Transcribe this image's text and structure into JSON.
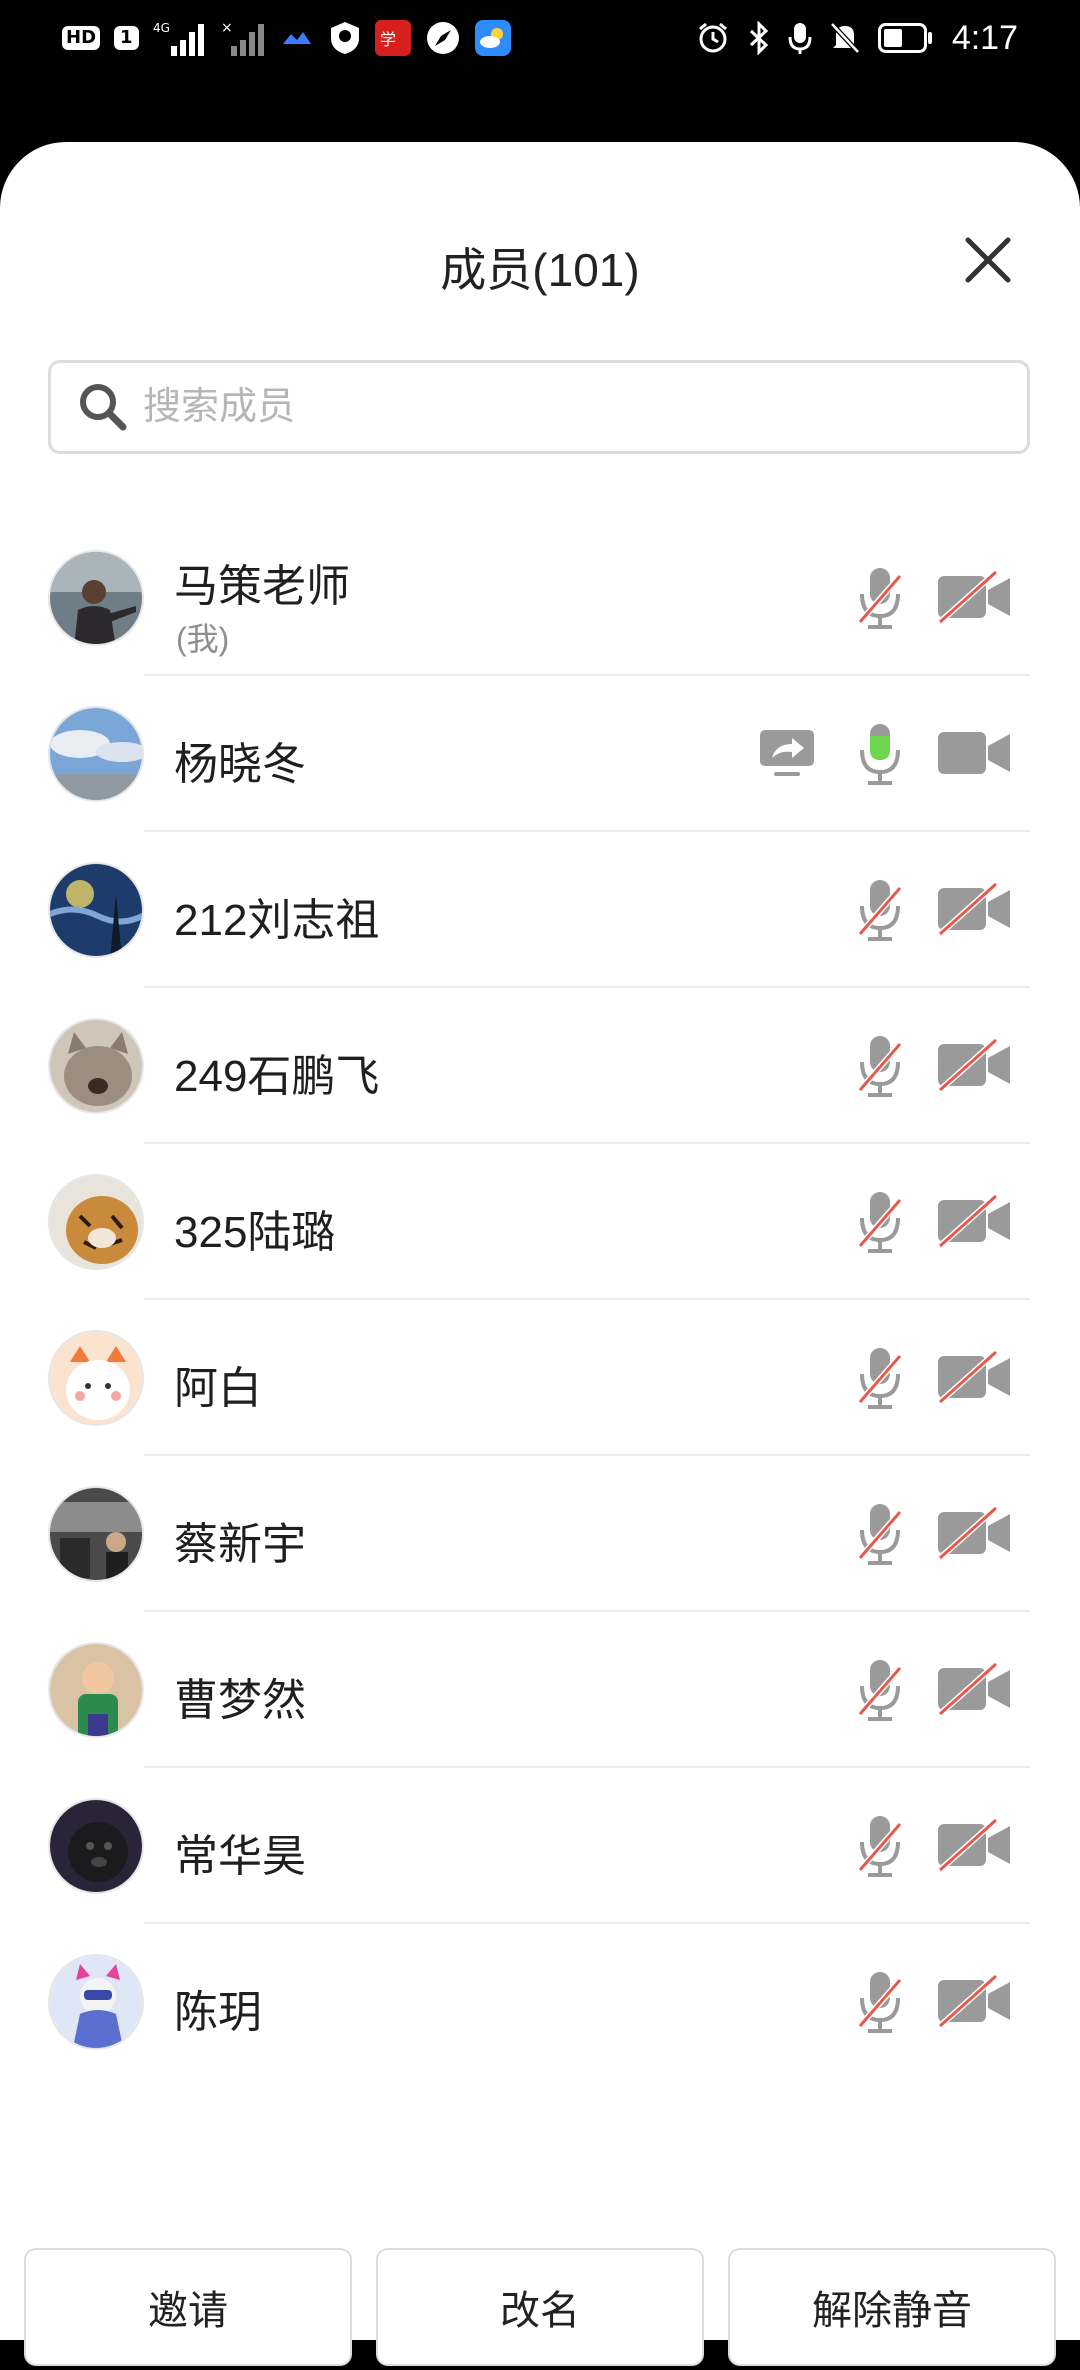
{
  "status_bar": {
    "time": "4:17",
    "left_icons": [
      "hd-icon",
      "sim-icon",
      "signal-4g-icon",
      "signal-x-icon",
      "app-cloud-icon",
      "shield-icon",
      "news-app-icon",
      "compass-icon",
      "weather-icon"
    ],
    "right_icons": [
      "alarm-icon",
      "bluetooth-icon",
      "mic-status-icon",
      "mute-bell-icon",
      "battery-icon"
    ]
  },
  "header": {
    "title": "成员(101)"
  },
  "search": {
    "placeholder": "搜索成员"
  },
  "members": [
    {
      "name": "马策老师",
      "sub": "(我)",
      "mic": "muted",
      "camera": "off",
      "sharing": false
    },
    {
      "name": "杨晓冬",
      "sub": "",
      "mic": "active",
      "camera": "on",
      "sharing": true
    },
    {
      "name": "212刘志祖",
      "sub": "",
      "mic": "muted",
      "camera": "off",
      "sharing": false
    },
    {
      "name": "249石鹏飞",
      "sub": "",
      "mic": "muted",
      "camera": "off",
      "sharing": false
    },
    {
      "name": "325陆璐",
      "sub": "",
      "mic": "muted",
      "camera": "off",
      "sharing": false
    },
    {
      "name": "阿白",
      "sub": "",
      "mic": "muted",
      "camera": "off",
      "sharing": false
    },
    {
      "name": "蔡新宇",
      "sub": "",
      "mic": "muted",
      "camera": "off",
      "sharing": false
    },
    {
      "name": "曹梦然",
      "sub": "",
      "mic": "muted",
      "camera": "off",
      "sharing": false
    },
    {
      "name": "常华昊",
      "sub": "",
      "mic": "muted",
      "camera": "off",
      "sharing": false
    },
    {
      "name": "陈玥",
      "sub": "",
      "mic": "muted",
      "camera": "off",
      "sharing": false
    }
  ],
  "actions": {
    "invite": "邀请",
    "rename": "改名",
    "unmute": "解除静音"
  },
  "colors": {
    "mic_active": "#6cd64f",
    "muted_slash": "#e8594c",
    "icon_gray": "#9a9a9a",
    "divider": "#ececec"
  }
}
